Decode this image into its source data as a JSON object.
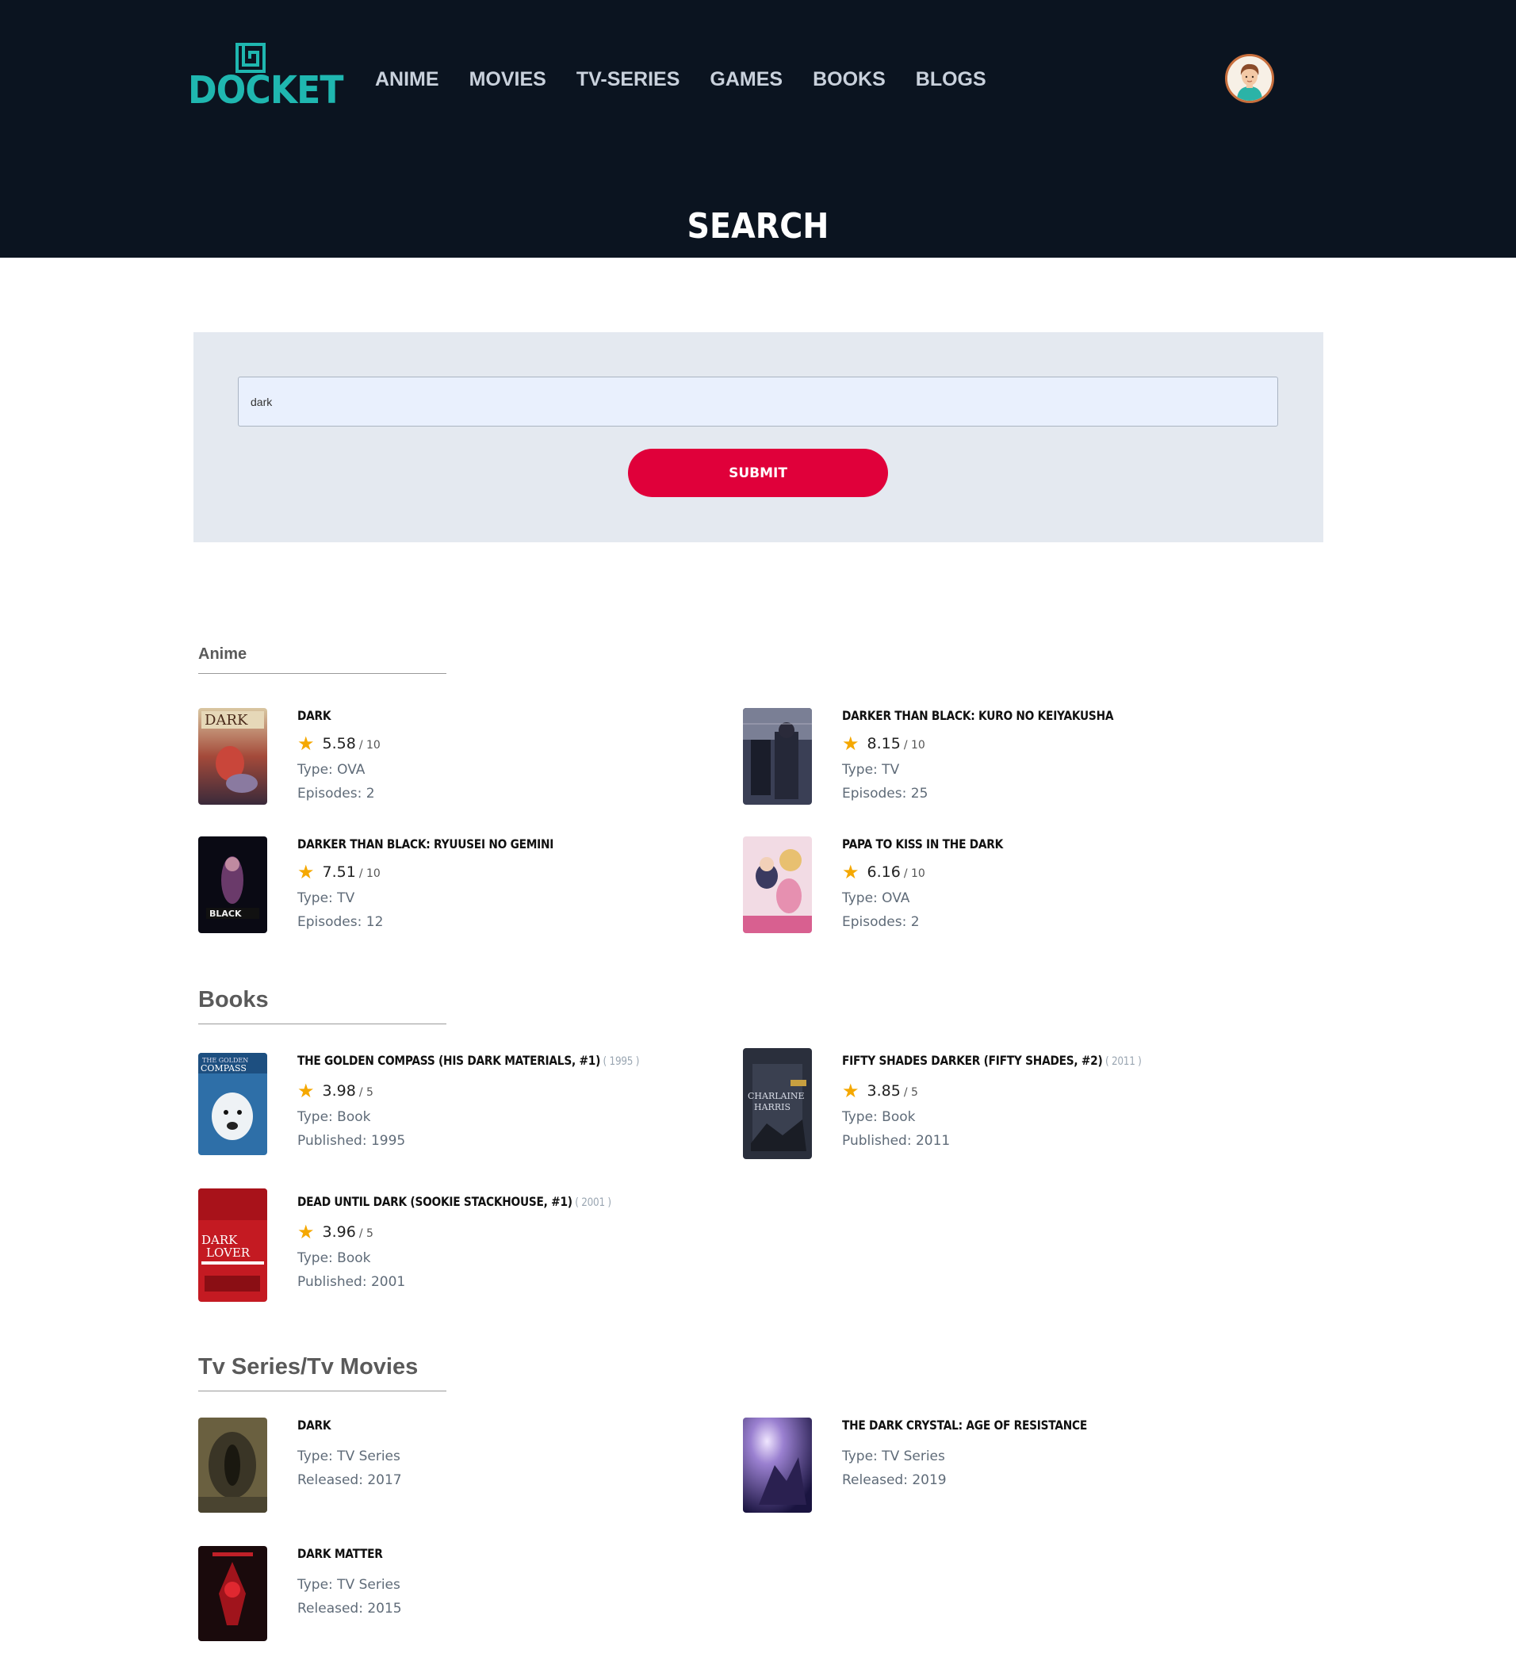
{
  "brand": {
    "name": "DOCKET"
  },
  "nav": [
    "ANIME",
    "MOVIES",
    "TV-SERIES",
    "GAMES",
    "BOOKS",
    "BLOGS"
  ],
  "page_title": "SEARCH",
  "search": {
    "value": "dark",
    "submit_label": "SUBMIT"
  },
  "sections": {
    "anime": {
      "title": "Anime",
      "items": [
        {
          "title": "DARK",
          "rating": "5.58",
          "scale": "/ 10",
          "type": "Type: OVA",
          "extra": "Episodes: 2"
        },
        {
          "title": "DARKER THAN BLACK: KURO NO KEIYAKUSHA",
          "rating": "8.15",
          "scale": "/ 10",
          "type": "Type: TV",
          "extra": "Episodes: 25"
        },
        {
          "title": "DARKER THAN BLACK: RYUUSEI NO GEMINI",
          "rating": "7.51",
          "scale": "/ 10",
          "type": "Type: TV",
          "extra": "Episodes: 12"
        },
        {
          "title": "PAPA TO KISS IN THE DARK",
          "rating": "6.16",
          "scale": "/ 10",
          "type": "Type: OVA",
          "extra": "Episodes: 2"
        }
      ]
    },
    "books": {
      "title": "Books",
      "items": [
        {
          "title": "THE GOLDEN COMPASS (HIS DARK MATERIALS, #1)",
          "year": "( 1995 )",
          "rating": "3.98",
          "scale": "/ 5",
          "type": "Type: Book",
          "extra": "Published: 1995"
        },
        {
          "title": "FIFTY SHADES DARKER (FIFTY SHADES, #2)",
          "year": "( 2011 )",
          "rating": "3.85",
          "scale": "/ 5",
          "type": "Type: Book",
          "extra": "Published: 2011"
        },
        {
          "title": "DEAD UNTIL DARK (SOOKIE STACKHOUSE, #1)",
          "year": "( 2001 )",
          "rating": "3.96",
          "scale": "/ 5",
          "type": "Type: Book",
          "extra": "Published: 2001"
        }
      ]
    },
    "tv": {
      "title": "Tv Series/Tv Movies",
      "items": [
        {
          "title": "DARK",
          "type": "Type: TV Series",
          "extra": "Released: 2017"
        },
        {
          "title": "THE DARK CRYSTAL: AGE OF RESISTANCE",
          "type": "Type: TV Series",
          "extra": "Released: 2019"
        },
        {
          "title": "DARK MATTER",
          "type": "Type: TV Series",
          "extra": "Released: 2015"
        }
      ]
    }
  },
  "colors": {
    "header_bg": "#0b1420",
    "brand": "#1fb7b0",
    "accent": "#e0003a",
    "star": "#f5a800",
    "panel_bg": "#e4e9f0"
  },
  "icons": {
    "rating": "star-icon",
    "profile": "user-avatar-icon",
    "logo": "docket-logo-icon"
  }
}
